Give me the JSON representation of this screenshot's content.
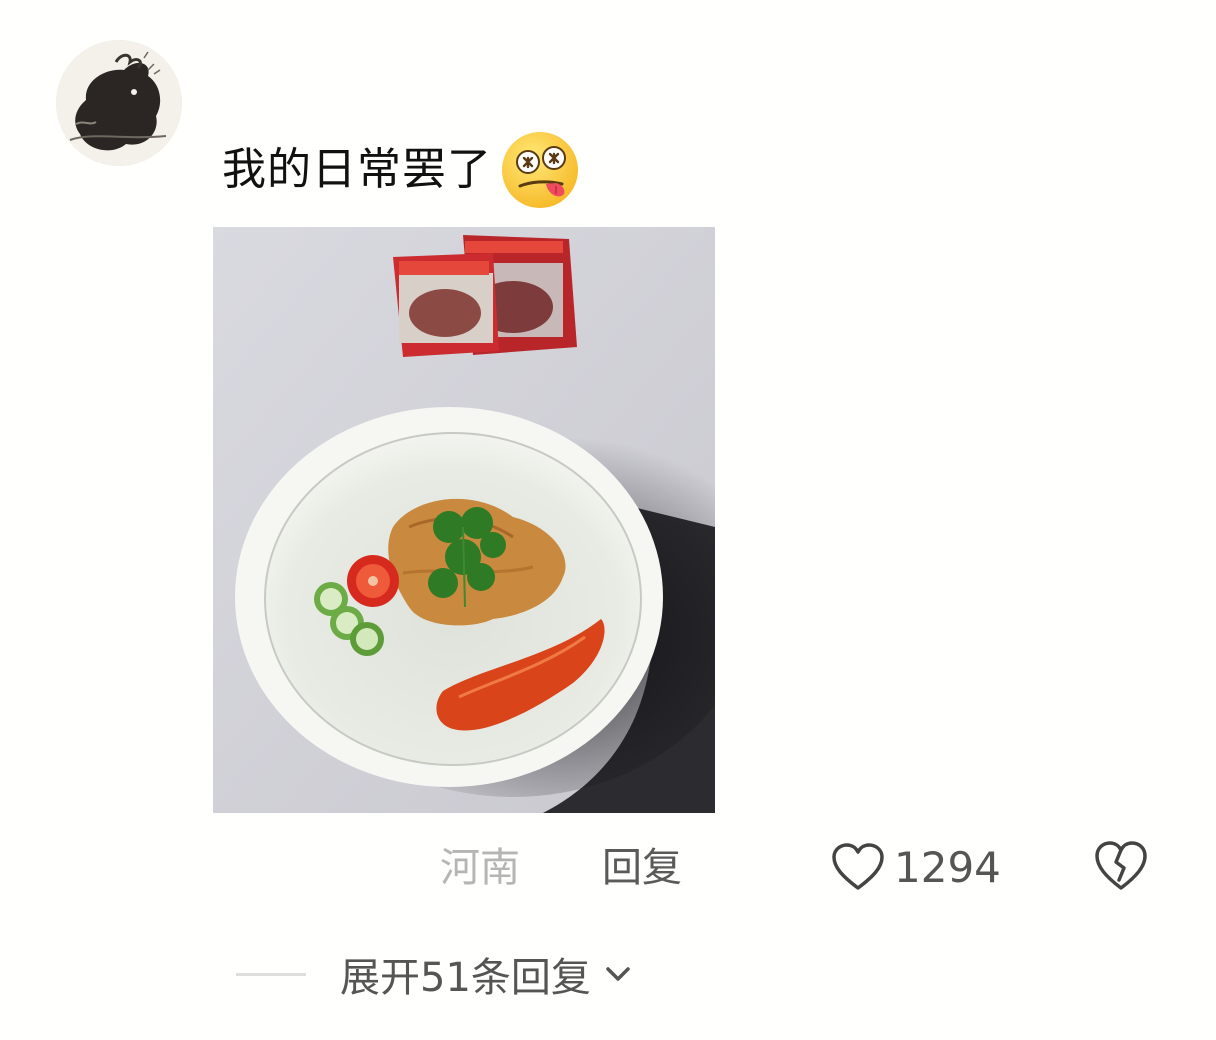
{
  "comment": {
    "text": "我的日常罢了",
    "emoji": "drooling-money-eyes-emoji"
  },
  "meta": {
    "location": "河南",
    "reply_label": "回复",
    "like_count": "1294"
  },
  "replies": {
    "expand_label": "展开51条回复"
  },
  "icons": {
    "like": "heart-outline-icon",
    "dislike": "broken-heart-icon",
    "expand": "chevron-down-icon"
  },
  "colors": {
    "text": "#111111",
    "secondary": "#555555",
    "muted": "#b5b5b5",
    "background": "#fffffd"
  }
}
